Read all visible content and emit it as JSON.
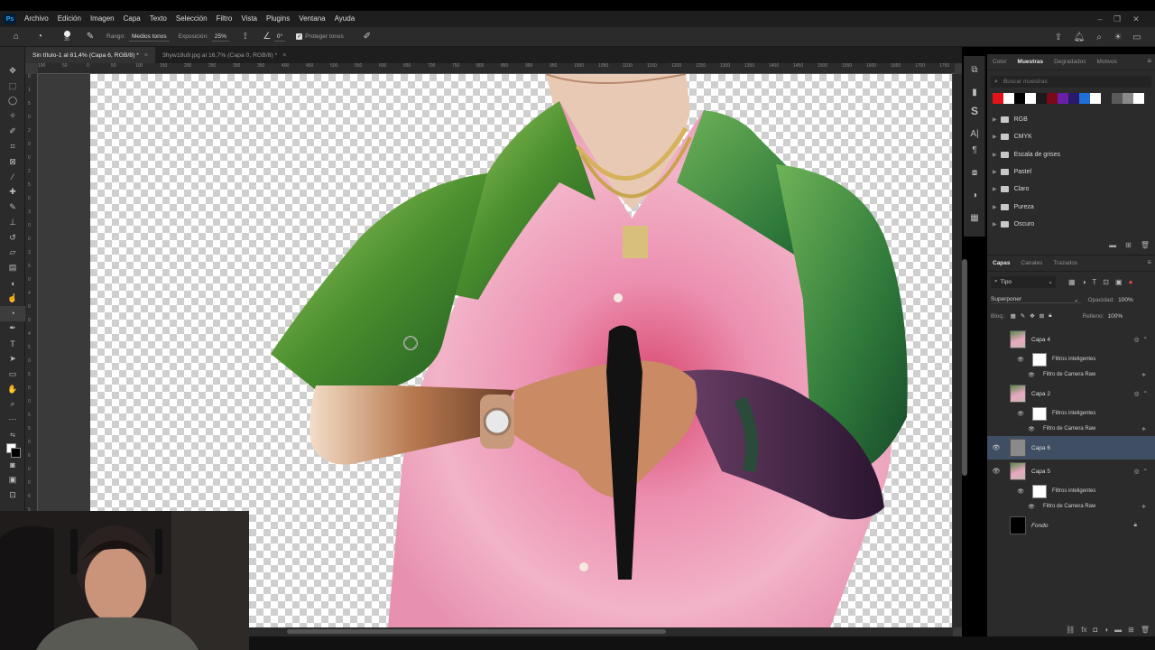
{
  "menubar": {
    "logo": "Ps",
    "items": [
      "Archivo",
      "Edición",
      "Imagen",
      "Capa",
      "Texto",
      "Selección",
      "Filtro",
      "Vista",
      "Plugins",
      "Ventana",
      "Ayuda"
    ]
  },
  "options": {
    "brush_size": "35",
    "range_label": "Rango:",
    "range_value": "Medios tonos",
    "exposure_label": "Exposición:",
    "exposure_value": "25%",
    "angle_value": "0°",
    "protect_label": "Proteger tonos"
  },
  "tabs": [
    {
      "label": "Sin título-1 al 81,4% (Capa 6, RGB/8) *",
      "active": true
    },
    {
      "label": "3hyw18u9.jpg al 16,7% (Capa 0, RGB/8) *",
      "active": false
    }
  ],
  "ruler": {
    "top": [
      "100",
      "50",
      "0",
      "50",
      "100",
      "150",
      "200",
      "250",
      "300",
      "350",
      "400",
      "450",
      "500",
      "550",
      "600",
      "650",
      "700",
      "750",
      "800",
      "850",
      "900",
      "950",
      "1000",
      "1050",
      "1100",
      "1150",
      "1200",
      "1250",
      "1300",
      "1350",
      "1400",
      "1450",
      "1500",
      "1550",
      "1600",
      "1650",
      "1700",
      "1750",
      "1800",
      "1850",
      "1900"
    ],
    "left": [
      "0",
      "1",
      "5",
      "0",
      "2",
      "0",
      "0",
      "2",
      "5",
      "0",
      "3",
      "0",
      "0",
      "3",
      "5",
      "0",
      "4",
      "0",
      "0",
      "4",
      "5",
      "0",
      "5",
      "0",
      "0",
      "5",
      "5",
      "0",
      "6",
      "0",
      "0",
      "6",
      "5",
      "0",
      "7",
      "0",
      "0",
      "7",
      "5",
      "0"
    ]
  },
  "swatches_panel": {
    "tabs": [
      "Color",
      "Muestras",
      "Degradados",
      "Motivos"
    ],
    "active_tab": "Muestras",
    "search_placeholder": "Buscar muestras",
    "colors": [
      "#e3121b",
      "#ffffff",
      "#000000",
      "#ffffff",
      "#1a1a1a",
      "#7a0a18",
      "#6a1fa8",
      "#2a1a6a",
      "#1f6fd8",
      "#ffffff",
      "#2a2a2a",
      "#5a5a5a",
      "#8a8a8a",
      "#ffffff"
    ],
    "folders": [
      "RGB",
      "CMYK",
      "Escala de grises",
      "Pastel",
      "Claro",
      "Pureza",
      "Oscuro"
    ]
  },
  "layers_panel": {
    "tabs": [
      "Capas",
      "Canales",
      "Trazados"
    ],
    "active_tab": "Capas",
    "kind": "Tipo",
    "blend_mode": "Superponer",
    "opacity_label": "Opacidad:",
    "opacity_value": "100%",
    "lock_label": "Bloq.:",
    "fill_label": "Relleno:",
    "fill_value": "100%",
    "layers": [
      {
        "name": "Capa 4",
        "visible": false,
        "kind": "photo"
      },
      {
        "name": "Filtros inteligentes",
        "kind": "smart"
      },
      {
        "name": "Filtro de Camera Raw",
        "kind": "filter"
      },
      {
        "name": "Capa 2",
        "visible": false,
        "kind": "photo"
      },
      {
        "name": "Filtros inteligentes",
        "kind": "smart"
      },
      {
        "name": "Filtro de Camera Raw",
        "kind": "filter"
      },
      {
        "name": "Capa 6",
        "visible": true,
        "kind": "gray",
        "selected": true
      },
      {
        "name": "Capa 5",
        "visible": true,
        "kind": "photo"
      },
      {
        "name": "Filtros inteligentes",
        "kind": "smart"
      },
      {
        "name": "Filtro de Camera Raw",
        "kind": "filter"
      },
      {
        "name": "Fondo",
        "visible": false,
        "kind": "black",
        "locked": true
      }
    ]
  }
}
